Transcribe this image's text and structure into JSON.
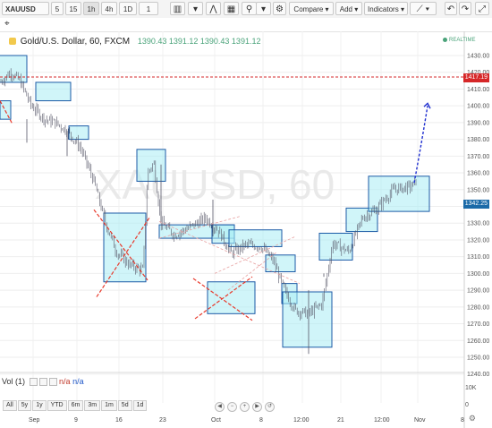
{
  "toolbar": {
    "symbol": "XAUUSD",
    "intervals": [
      "5",
      "15",
      "1h",
      "4h",
      "1D",
      "1"
    ],
    "active_interval": "1h",
    "compare_label": "Compare",
    "add_label": "Add",
    "indicators_label": "Indicators"
  },
  "legend": {
    "title": "Gold/U.S. Dollar, 60, FXCM",
    "values": "1390.43 1391.12 1390.43 1391.12"
  },
  "realtime_label": "REALTIME",
  "watermark": {
    "symbol": "XAUUSD, 60"
  },
  "price_axis": {
    "labels": [
      "1430.00",
      "1420.00",
      "1410.00",
      "1400.00",
      "1390.00",
      "1380.00",
      "1370.00",
      "1360.00",
      "1350.00",
      "1340.00",
      "1330.00",
      "1320.00",
      "1310.00",
      "1300.00",
      "1290.00",
      "1280.00",
      "1270.00",
      "1260.00",
      "1250.00",
      "1240.00"
    ],
    "resistance_tag": "1417.19",
    "current_tag": "1342.25"
  },
  "volume": {
    "label": "Vol (1)",
    "value1": "n/a",
    "value2": "n/a",
    "axis_labels": [
      "10K",
      "0"
    ]
  },
  "range_buttons": [
    "All",
    "5y",
    "1y",
    "YTD",
    "6m",
    "3m",
    "1m",
    "5d",
    "1d"
  ],
  "time_axis": [
    "Sep",
    "9",
    "16",
    "23",
    "Oct",
    "8",
    "12:00",
    "21",
    "12:00",
    "Nov",
    "8"
  ],
  "colors": {
    "resistance": "#d62728",
    "box_fill": "#a9ecf4",
    "box_stroke": "#1b5aa6",
    "cross": "#e8392b",
    "projection": "#1f2fd0",
    "candle": "#556"
  }
}
